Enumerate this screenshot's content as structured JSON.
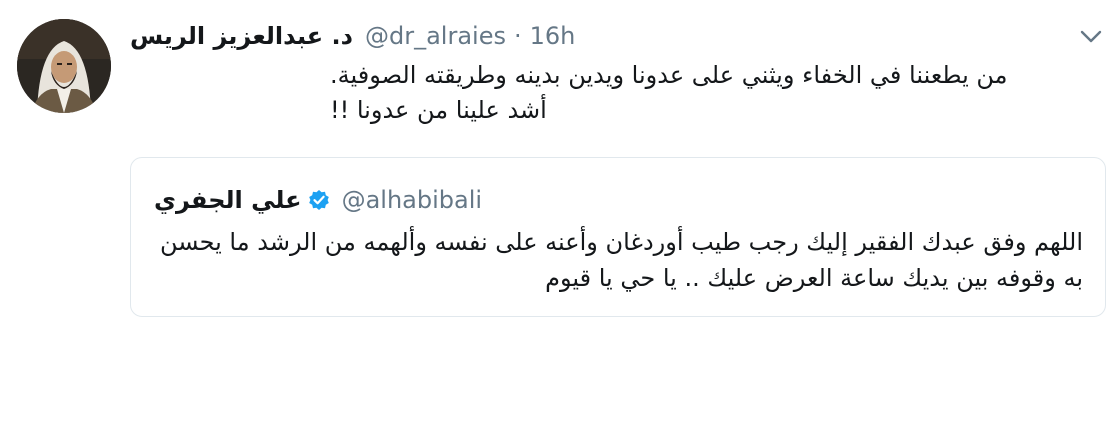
{
  "tweet": {
    "display_name": "د. عبدالعزيز الريس",
    "handle": "@dr_alraies",
    "separator": "·",
    "time": "16h",
    "text_lines": [
      "من يطعننا في الخفاء ويثني على عدونا ويدين بدينه وطريقته الصوفية.",
      "أشد علينا من عدونا !!"
    ],
    "avatar_icon": "profile-photo",
    "menu_icon": "chevron-down-icon"
  },
  "quoted_tweet": {
    "display_name": "علي الجفري",
    "verified_icon": "verified-badge-icon",
    "handle": "@alhabibali",
    "text": "اللهم وفق عبدك الفقير إليك رجب طيب أوردغان وأعنه على نفسه وألهمه من الرشد ما يحسن به وقوفه بين يديك ساعة العرض عليك .. يا حي يا قيوم"
  },
  "colors": {
    "primary_text": "#14171a",
    "secondary_text": "#657786",
    "border": "#e1e8ed",
    "verified_blue": "#1da1f2"
  }
}
